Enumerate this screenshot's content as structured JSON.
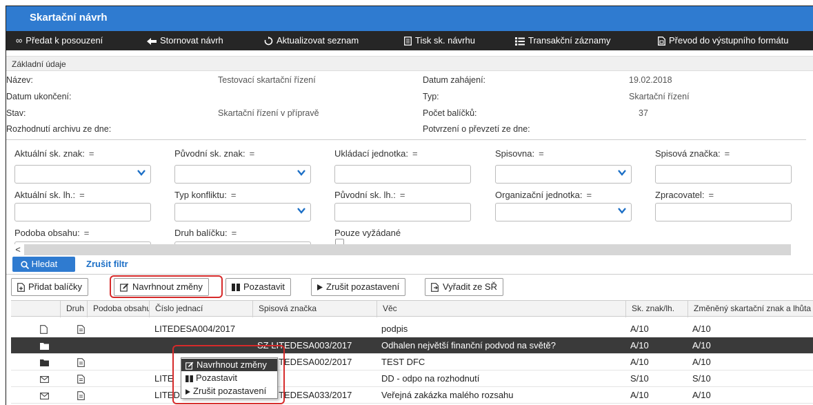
{
  "app": {
    "title": "Skartační návrh"
  },
  "toolbar": {
    "items": [
      {
        "label": "Předat k posouzení",
        "icon": "∞"
      },
      {
        "label": "Stornovat návrh",
        "icon": "◀"
      },
      {
        "label": "Aktualizovat seznam",
        "icon": "⟳"
      },
      {
        "label": "Tisk sk. návrhu",
        "icon": "▤"
      },
      {
        "label": "Transakční záznamy",
        "icon": "☰"
      },
      {
        "label": "Převod do výstupního formátu",
        "icon": "▦"
      }
    ]
  },
  "basic": {
    "header": "Základní údaje",
    "nazev_label": "Název:",
    "nazev_value": "Testovací skartační řízení",
    "datum_zahajeni_label": "Datum zahájení:",
    "datum_zahajeni_value": "19.02.2018",
    "datum_ukonceni_label": "Datum ukončení:",
    "typ_label": "Typ:",
    "typ_value": "Skartační řízení",
    "stav_label": "Stav:",
    "stav_value": "Skartační řízení v přípravě",
    "pocet_label": "Počet balíčků:",
    "pocet_value": "37",
    "rozhodnuti_label": "Rozhodnutí archivu ze dne:",
    "potvrzeni_label": "Potvrzení o převzetí ze dne:"
  },
  "filters": {
    "eq": "=",
    "aktualni_znak": "Aktuální sk. znak:",
    "puvodni_znak": "Původní sk. znak:",
    "ukladaci_jednotka": "Ukládací jednotka:",
    "spisovna": "Spisovna:",
    "spisova_znacka": "Spisová značka:",
    "aktualni_lh": "Aktuální sk. lh.:",
    "typ_konfliktu": "Typ konfliktu:",
    "puvodni_lh": "Původní sk. lh.:",
    "org_jednotka": "Organizační jednotka:",
    "zpracovatel": "Zpracovatel:",
    "podoba_obsahu": "Podoba obsahu:",
    "druh_balicku": "Druh balíčku:",
    "pouze_vyzadane": "Pouze vyžádané",
    "search_label": "Hledat",
    "cancel_label": "Zrušit filtr",
    "scroll_left": "<"
  },
  "actions": {
    "pridat": "Přidat balíčky",
    "navrhnout": "Navrhnout změny",
    "pozastavit": "Pozastavit",
    "zrusit": "Zrušit pozastavení",
    "vyradit": "Vyřadit ze SŘ"
  },
  "table": {
    "columns": [
      "Druh",
      "Podoba obsahu",
      "Číslo jednací",
      "Spisová značka",
      "Věc",
      "Sk. znak/lh.",
      "Změněný skartační znak a lhůta"
    ],
    "rows": [
      {
        "cislo": "LITEDESA004/2017",
        "znacka": "",
        "vec": "podpis",
        "znak": "A/10",
        "zmeneny": "A/10"
      },
      {
        "cislo": "",
        "znacka": "SZ LITEDESA003/2017",
        "vec": "Odhalen největší finanční podvod na světě?",
        "znak": "A/10",
        "zmeneny": "A/10"
      },
      {
        "cislo": "",
        "znacka": "SZ LITEDESA002/2017",
        "vec": "TEST DFC",
        "znak": "A/10",
        "zmeneny": "A/10"
      },
      {
        "cislo": "LITE",
        "znacka": "",
        "vec": "DD - odpo na rozhodnutí",
        "znak": "S/10",
        "zmeneny": "S/10"
      },
      {
        "cislo": "LITEDESA040/2017",
        "znacka": "SZ LITEDESA033/2017",
        "vec": "Veřejná zakázka malého rozsahu",
        "znak": "A/10",
        "zmeneny": "A/10"
      }
    ]
  },
  "context_menu": {
    "navrhnout": "Navrhnout změny",
    "pozastavit": "Pozastavit",
    "zrusit": "Zrušit pozastavení"
  },
  "colors": {
    "accent": "#2f7bd0",
    "toolbar": "#262626",
    "highlight": "#d62a2a"
  }
}
